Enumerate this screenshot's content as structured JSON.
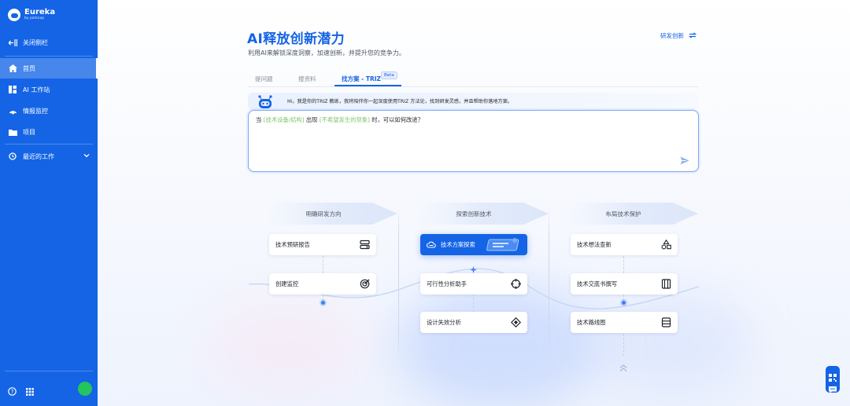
{
  "brand": {
    "name": "Eureka",
    "sub": "by patsnap",
    "logo_icon": "eureka-logo-icon"
  },
  "sidebar": {
    "collapse": {
      "label": "关闭侧栏",
      "icon": "collapse-sidebar-icon"
    },
    "items": [
      {
        "label": "首页",
        "icon": "home-icon",
        "active": true
      },
      {
        "label": "AI 工作站",
        "icon": "workstation-icon"
      },
      {
        "label": "情报监控",
        "icon": "monitor-icon"
      },
      {
        "label": "项目",
        "icon": "folder-icon"
      }
    ],
    "recent": {
      "label": "最近的工作",
      "icon": "history-icon"
    },
    "bottom": {
      "help_icon": "help-icon",
      "apps_icon": "apps-grid-icon",
      "avatar_color": "#22c55e"
    },
    "bg_color": "#1464e5"
  },
  "header": {
    "title": "AI释放创新潜力",
    "subtitle": "利用AI来解锁深度洞察，加速创新，并提升您的竞争力。",
    "switch_label": "研发创新",
    "switch_icon": "swap-icon"
  },
  "tabs": [
    {
      "label": "提问题"
    },
    {
      "label": "搜资料"
    },
    {
      "label": "找方案 - TRIZ",
      "badge": "Beta",
      "active": true
    }
  ],
  "assistant": {
    "greeting": "Hi，我是你的TRIZ 教练，我将陪伴你一起深度使用TRIZ 方法论，找到研发灵感，并且帮助你落地方案。",
    "avatar_icon": "robot-icon"
  },
  "input": {
    "prefix": "当",
    "slot1": "[技术设备/结构]",
    "mid": "出现",
    "slot2": "[不希望发生的现象]",
    "suffix": "时，可以如何改进？",
    "send_icon": "send-icon"
  },
  "columns": [
    {
      "title": "明确研发方向",
      "cards": [
        {
          "label": "技术预研报告",
          "icon": "report-icon"
        },
        {
          "label": "创建监控",
          "icon": "target-icon"
        }
      ]
    },
    {
      "title": "探索创新技术",
      "cards": [
        {
          "label": "技术方案探索",
          "icon": "solution-explore-icon",
          "primary": true
        },
        {
          "label": "可行性分析助手",
          "icon": "crosshair-icon"
        },
        {
          "label": "设计失效分析",
          "icon": "diamond-icon"
        }
      ]
    },
    {
      "title": "布局技术保护",
      "cards": [
        {
          "label": "技术想法查新",
          "icon": "shapes-icon"
        },
        {
          "label": "技术交底书撰写",
          "icon": "book-icon"
        },
        {
          "label": "技术路线图",
          "icon": "stack-icon"
        }
      ]
    }
  ],
  "float_widget": {
    "icons": [
      "qr-code-icon",
      "chat-icon"
    ]
  },
  "colors": {
    "accent": "#1464e5",
    "highlight": "#7fc56e"
  }
}
